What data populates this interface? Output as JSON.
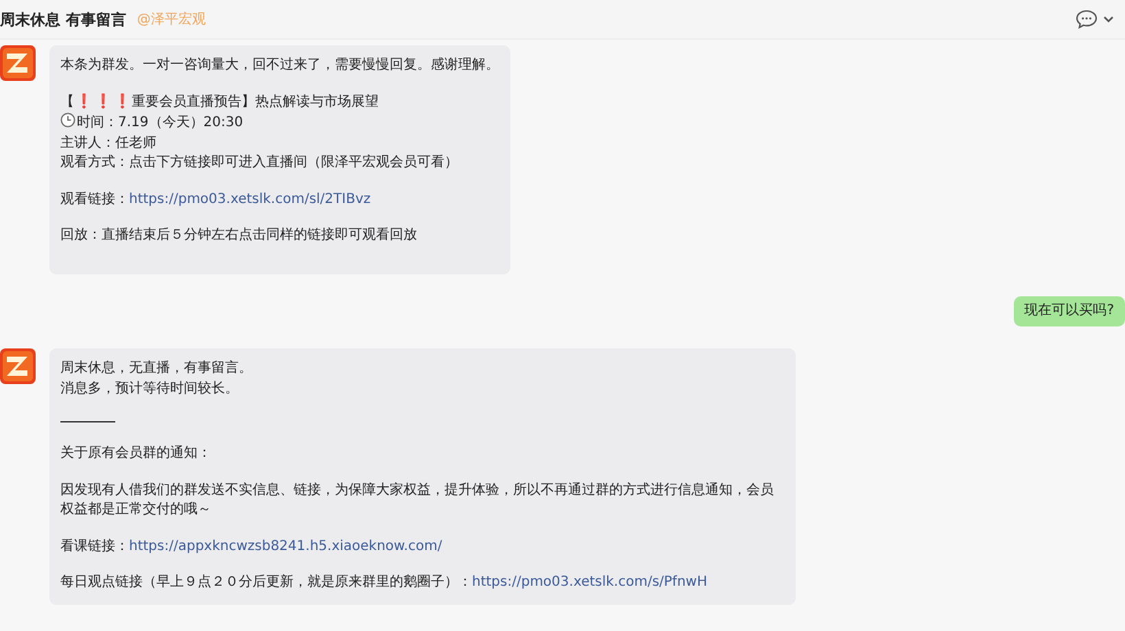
{
  "header": {
    "title": "周末休息 有事留言",
    "mention": "@泽平宏观"
  },
  "messages": [
    {
      "kind": "incoming",
      "lines": [
        {
          "kind": "text",
          "text": "本条为群发。一对一咨询量大，回不过来了，需要慢慢回复。感谢理解。"
        },
        {
          "kind": "gap"
        },
        {
          "kind": "alert",
          "open": "【",
          "marks": [
            "❗",
            "❗",
            "❗"
          ],
          "rest": "重要会员直播预告】热点解读与市场展望"
        },
        {
          "kind": "time",
          "text": "时间：7.19（今天）20:30"
        },
        {
          "kind": "text",
          "text": "主讲人：任老师"
        },
        {
          "kind": "text",
          "text": "观看方式：点击下方链接即可进入直播间（限泽平宏观会员可看）"
        },
        {
          "kind": "gap"
        },
        {
          "kind": "link",
          "label": "观看链接：",
          "url": "https://pmo03.xetslk.com/sl/2TIBvz"
        },
        {
          "kind": "gap"
        },
        {
          "kind": "text",
          "text": "回放：直播结束后５分钟左右点击同样的链接即可观看回放"
        },
        {
          "kind": "gap"
        }
      ]
    },
    {
      "kind": "outgoing",
      "text": "现在可以买吗?"
    },
    {
      "kind": "incoming",
      "lines": [
        {
          "kind": "text",
          "text": "周末休息，无直播，有事留言。"
        },
        {
          "kind": "text",
          "text": "消息多，预计等待时间较长。"
        },
        {
          "kind": "gap"
        },
        {
          "kind": "rule"
        },
        {
          "kind": "gap"
        },
        {
          "kind": "text",
          "text": "关于原有会员群的通知："
        },
        {
          "kind": "gap"
        },
        {
          "kind": "text",
          "text": "因发现有人借我们的群发送不实信息、链接，为保障大家权益，提升体验，所以不再通过群的方式进行信息通知，会员权益都是正常交付的哦～"
        },
        {
          "kind": "gap"
        },
        {
          "kind": "link",
          "label": "看课链接：",
          "url": "https://appxkncwzsb8241.h5.xiaoeknow.com/"
        },
        {
          "kind": "gap"
        },
        {
          "kind": "link",
          "label": "每日观点链接（早上９点２０分后更新，就是原来群里的鹅圈子）：",
          "url": "https://pmo03.xetslk.com/s/PfnwH"
        }
      ]
    }
  ]
}
